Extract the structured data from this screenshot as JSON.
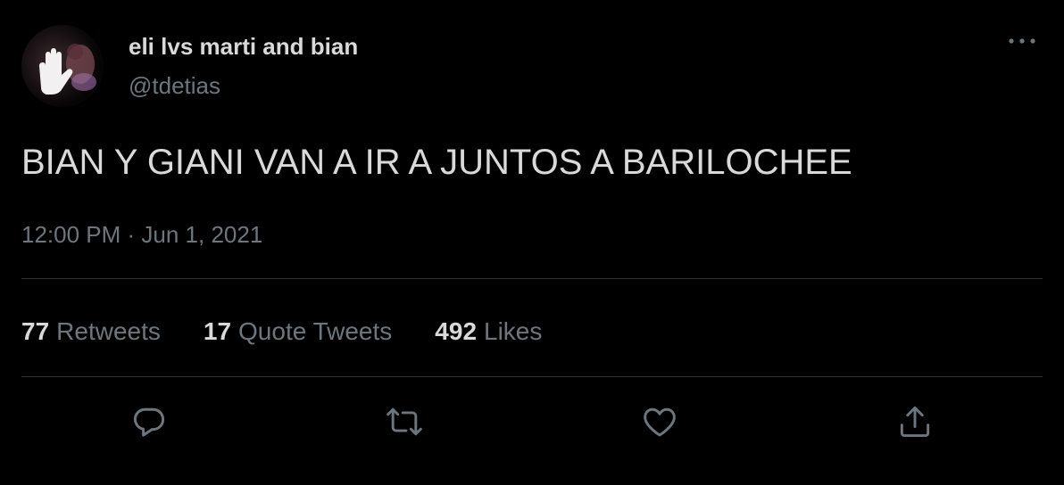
{
  "author": {
    "display_name": "eli lvs marti and bian",
    "handle": "@tdetias",
    "avatar_icon": "profile-photo"
  },
  "more_icon": "more-horizontal-icon",
  "tweet": {
    "text": "BIAN Y GIANI VAN A IR A JUNTOS A BARILOCHEE",
    "timestamp": "12:00 PM · Jun 1, 2021"
  },
  "stats": [
    {
      "count": "77",
      "label": "Retweets"
    },
    {
      "count": "17",
      "label": "Quote Tweets"
    },
    {
      "count": "492",
      "label": "Likes"
    }
  ],
  "actions": [
    {
      "name": "reply",
      "icon": "reply-bubble-icon"
    },
    {
      "name": "retweet",
      "icon": "retweet-arrows-icon"
    },
    {
      "name": "like",
      "icon": "heart-icon"
    },
    {
      "name": "share",
      "icon": "share-upload-icon"
    }
  ],
  "colors": {
    "background": "#000000",
    "primary_text": "#d9d9d9",
    "secondary_text": "#6e767d",
    "divider": "#2f3336"
  }
}
